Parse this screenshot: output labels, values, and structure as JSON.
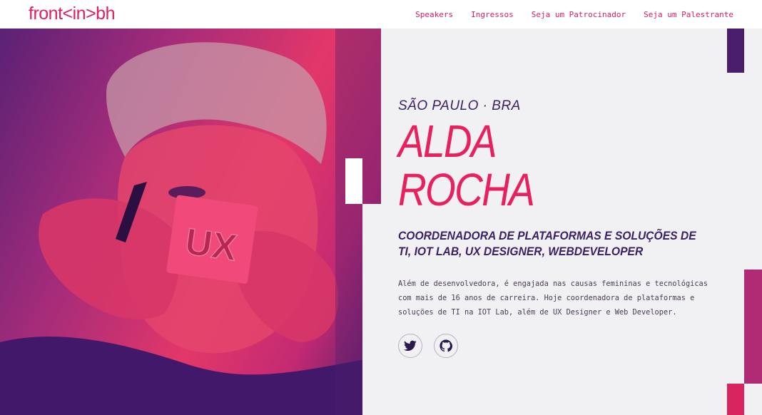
{
  "header": {
    "logo": "front<in>bh",
    "nav": [
      "Speakers",
      "Ingressos",
      "Seja um Patrocinador",
      "Seja um Palestrante"
    ]
  },
  "speaker": {
    "location": "SÃO PAULO · BRA",
    "first_name": "ALDA",
    "last_name": "ROCHA",
    "role": "COORDENADORA DE PLATAFORMAS E SOLUÇÕES DE TI, IOT LAB, UX DESIGNER, WEBDEVELOPER",
    "bio": "Além de desenvolvedora, é engajada nas causas femininas e tecnológicas com mais de 16 anos de carreira. Hoje coordenadora de plataformas e soluções de TI na IOT Lab, além de UX Designer e Web Developer.",
    "photo_card_text": "UX"
  },
  "social": [
    "twitter-icon",
    "github-icon"
  ],
  "colors": {
    "accent": "#e8215e",
    "navy": "#3a2163",
    "purple": "#4a1e6c"
  }
}
